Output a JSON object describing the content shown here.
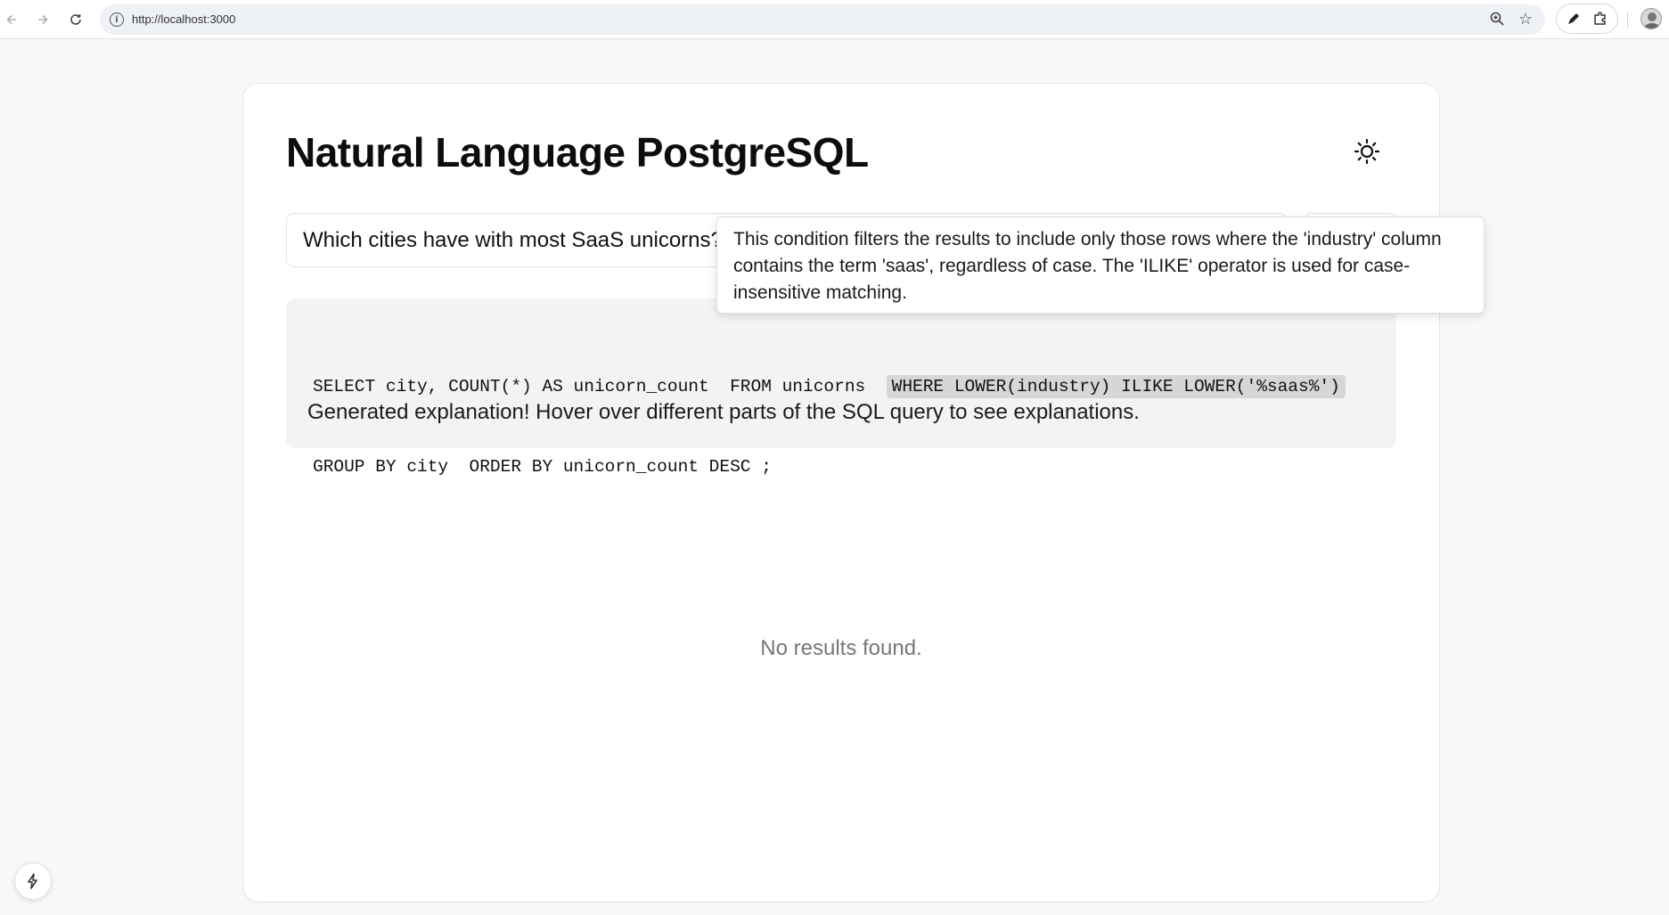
{
  "browser": {
    "url": "http://localhost:3000",
    "icons": [
      "back-arrow-icon",
      "forward-arrow-icon",
      "reload-icon",
      "info-icon",
      "zoom-icon",
      "star-icon",
      "pen-icon",
      "puzzle-icon",
      "profile-avatar"
    ]
  },
  "app": {
    "title": "Natural Language PostgreSQL",
    "theme_icon": "sun-icon"
  },
  "query": {
    "value": "Which cities have with most SaaS unicorns?"
  },
  "sql": {
    "line1": [
      {
        "text": "SELECT city, COUNT(*) AS unicorn_count",
        "highlighted": false
      },
      {
        "text": "FROM unicorns",
        "highlighted": false
      },
      {
        "text": "WHERE LOWER(industry) ILIKE LOWER('%saas%')",
        "highlighted": true
      }
    ],
    "line2": [
      {
        "text": "GROUP BY city",
        "highlighted": false
      },
      {
        "text": "ORDER BY unicorn_count DESC",
        "highlighted": false
      },
      {
        "text": ";",
        "highlighted": false
      }
    ]
  },
  "explanation_status": "Generated explanation! Hover over different parts of the SQL query to see explanations.",
  "tooltip": {
    "text": "This condition filters the results to include only those rows where the 'industry' column contains the term 'saas', regardless of case. The 'ILIKE' operator is used for case-insensitive matching."
  },
  "results": {
    "empty_message": "No results found."
  },
  "colors": {
    "highlight": "#d6d6d6",
    "panel": "#f3f3f3",
    "muted_text": "#777777"
  }
}
